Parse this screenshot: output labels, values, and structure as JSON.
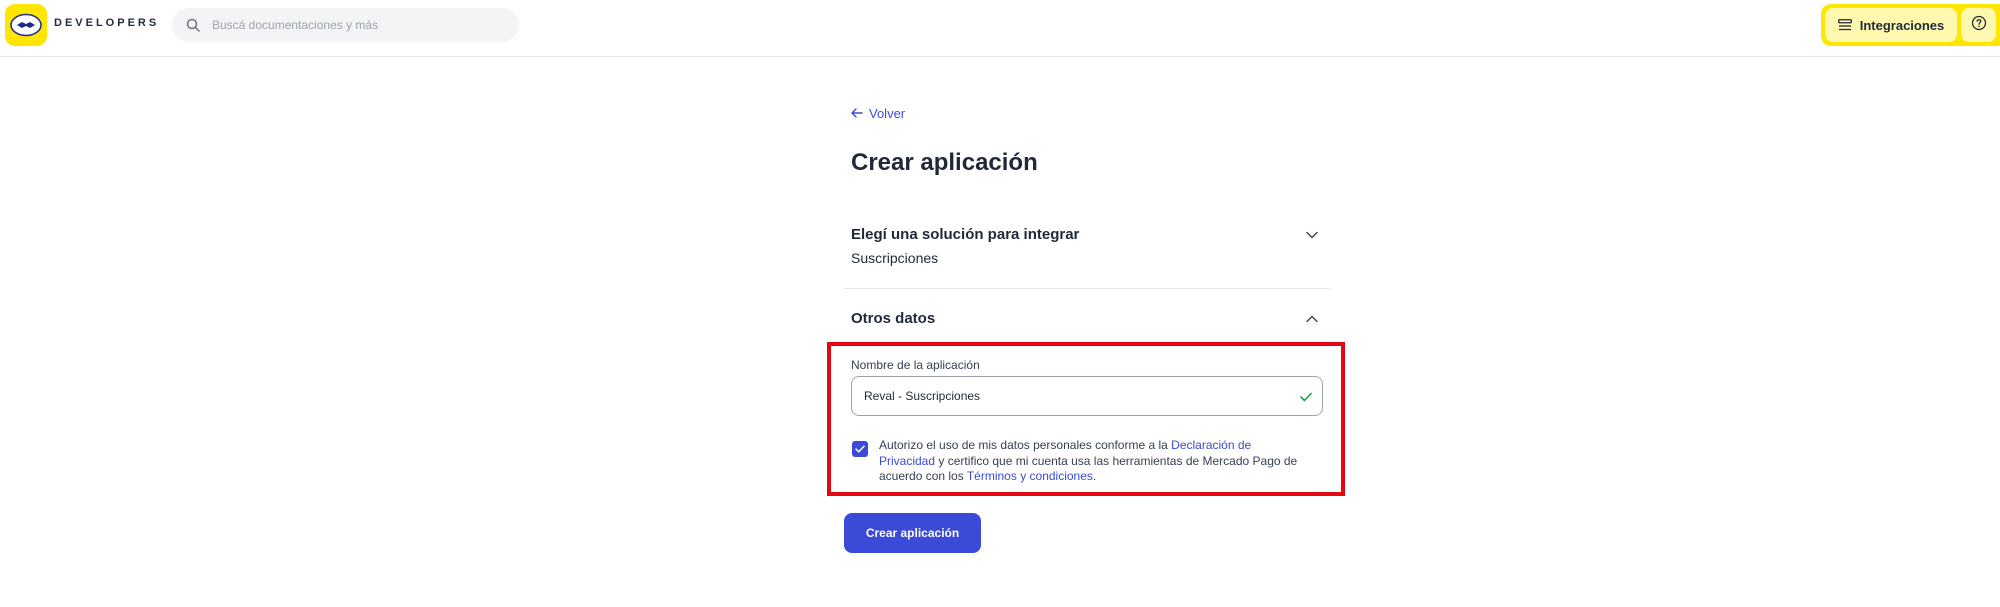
{
  "header": {
    "brand": "DEVELOPERS",
    "search_placeholder": "Buscá documentaciones y más",
    "integraciones_label": "Integraciones"
  },
  "main": {
    "back_label": "Volver",
    "title": "Crear aplicación",
    "section_solution": {
      "title": "Elegí una solución para integrar",
      "value": "Suscripciones"
    },
    "section_other": {
      "title": "Otros datos",
      "app_name_label": "Nombre de la aplicación",
      "app_name_value": "Reval - Suscripciones",
      "consent": {
        "checked": true,
        "text_1": "Autorizo el uso de mis datos personales conforme a la ",
        "link_privacy": "Declaración de Privacidad",
        "text_2": " y certifico que mi cuenta usa las herramientas de Mercado Pago de acuerdo con los ",
        "link_terms": "Términos y condiciones",
        "text_3": "."
      }
    },
    "submit_label": "Crear aplicación"
  },
  "colors": {
    "brand_yellow": "#ffe600",
    "accent_blue": "#3b4bd8",
    "highlight_red": "#e30613",
    "valid_green": "#16a34a"
  },
  "icons": [
    "logo-handshake-icon",
    "search-icon",
    "list-icon",
    "help-icon",
    "arrow-left-icon",
    "chevron-down-icon",
    "chevron-up-icon",
    "check-icon"
  ]
}
